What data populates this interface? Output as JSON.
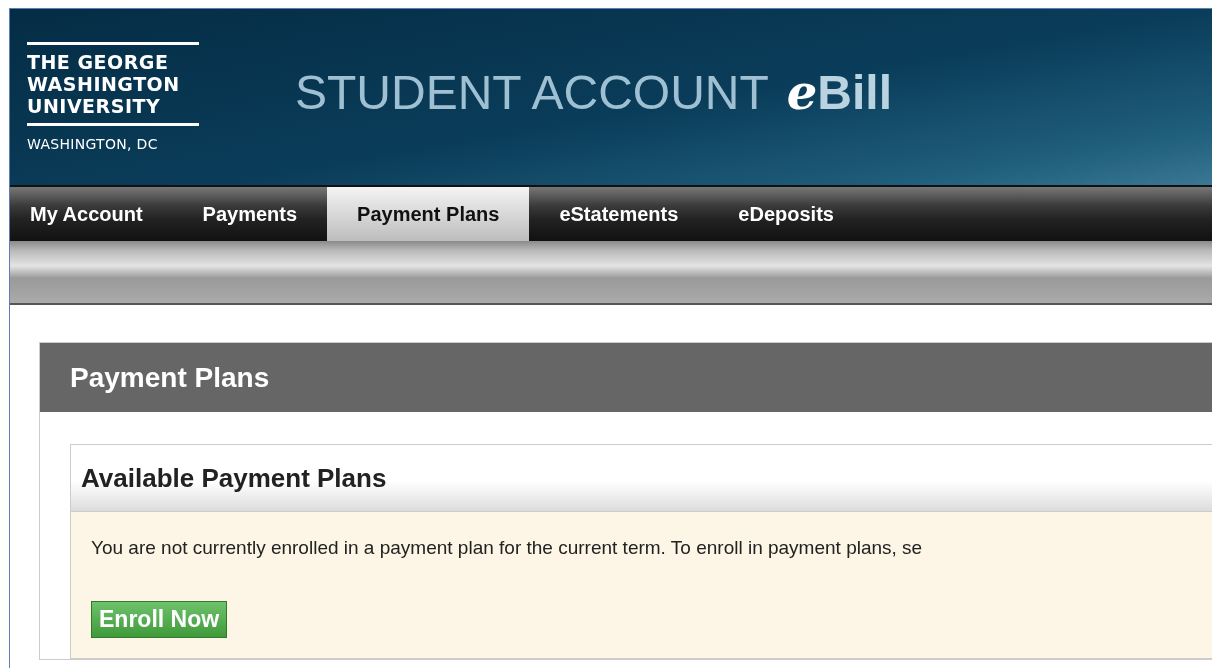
{
  "header": {
    "logo_lines": [
      "THE GEORGE",
      "WASHINGTON",
      "UNIVERSITY"
    ],
    "logo_location": "WASHINGTON, DC",
    "title": "STUDENT ACCOUNT",
    "brand": "eBill"
  },
  "tabs": [
    {
      "label": "My Account",
      "selected": false
    },
    {
      "label": "Payments",
      "selected": false
    },
    {
      "label": "Payment Plans",
      "selected": true
    },
    {
      "label": "eStatements",
      "selected": false
    },
    {
      "label": "eDeposits",
      "selected": false
    }
  ],
  "panel": {
    "title": "Payment Plans",
    "section": {
      "title": "Available Payment Plans",
      "message": "You are not currently enrolled in a payment plan for the current term. To enroll in payment plans, se",
      "button": "Enroll Now"
    }
  }
}
